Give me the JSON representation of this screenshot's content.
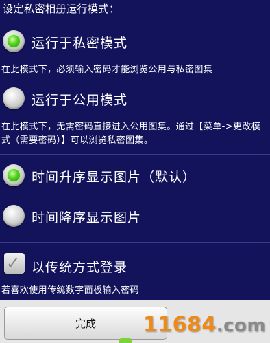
{
  "section_title": "设定私密相册运行模式：",
  "options": [
    {
      "label": "运行于私密模式",
      "selected": true
    },
    {
      "label": "运行于公用模式",
      "selected": false
    },
    {
      "label": "时间升序显示图片（默认）",
      "selected": true
    },
    {
      "label": "时间降序显示图片",
      "selected": false
    }
  ],
  "descriptions": {
    "private_mode": "在此模式下，必须输入密码才能浏览公用与私密图集",
    "public_mode": "在此模式下，无需密码直接进入公用图集。通过【菜单->更改模式（需要密码）】可以浏览私密图集。"
  },
  "checkbox": {
    "label": "以传统方式登录",
    "checked": true,
    "hint": "若喜欢使用传统数字面板输入密码"
  },
  "done_button": "完成",
  "watermark": {
    "number": "11684",
    "domain": ".com"
  },
  "colors": {
    "background": "#13135c",
    "radio_on": "#55d120",
    "text": "#ffffff",
    "button_bar": "#e6e6e6"
  }
}
